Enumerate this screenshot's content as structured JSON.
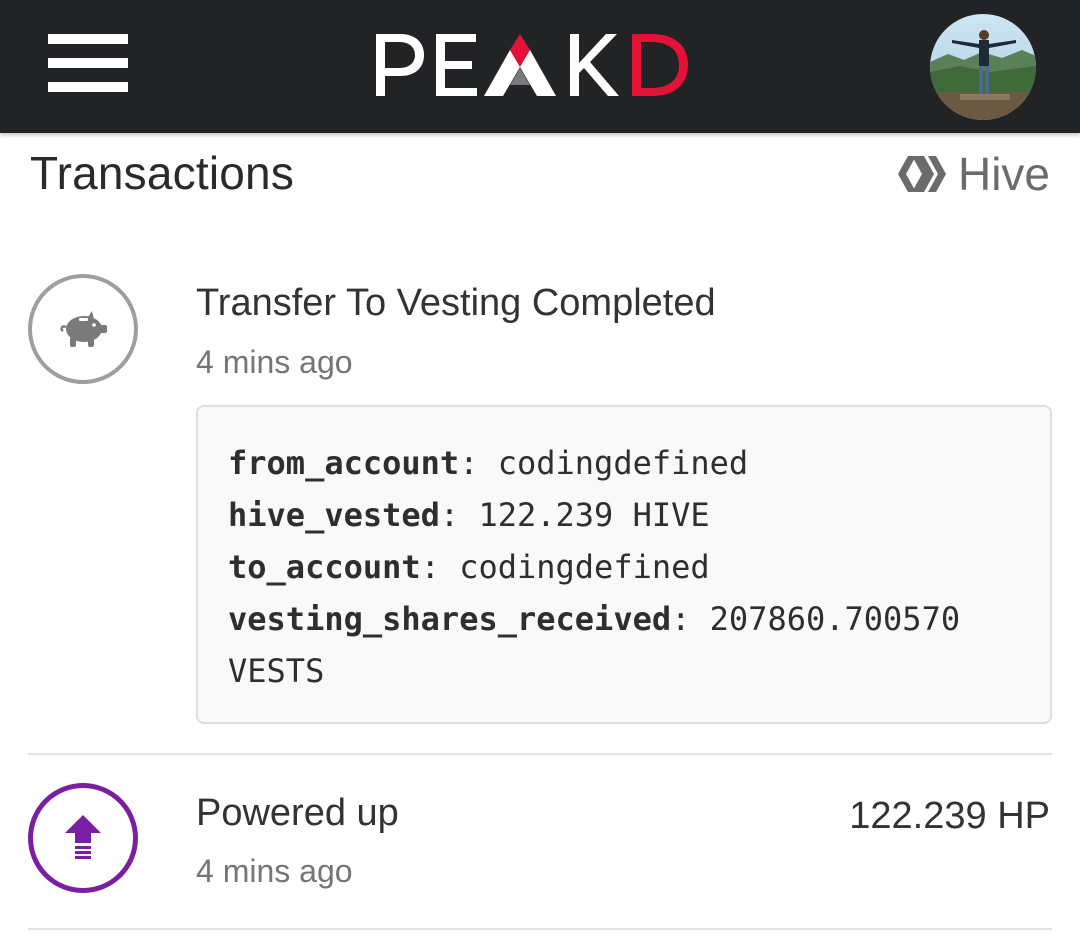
{
  "header": {
    "logo_text": "PEAKD",
    "menu_icon": "hamburger-menu-icon",
    "avatar_icon": "user-avatar"
  },
  "page": {
    "title": "Transactions",
    "network_label": "Hive",
    "network_icon": "hive-logo-icon"
  },
  "transactions": [
    {
      "title": "Transfer To Vesting Completed",
      "time": "4 mins ago",
      "icon": "piggy-bank-icon",
      "details": [
        {
          "key": "from_account",
          "value": "codingdefined"
        },
        {
          "key": "hive_vested",
          "value": "122.239 HIVE"
        },
        {
          "key": "to_account",
          "value": "codingdefined"
        },
        {
          "key": "vesting_shares_received",
          "value": "207860.700570 VESTS"
        }
      ]
    },
    {
      "title": "Powered up",
      "time": "4 mins ago",
      "amount": "122.239 HP",
      "icon": "power-up-arrow-icon"
    }
  ],
  "colors": {
    "topbar": "#222324",
    "logo_accent": "#e31337",
    "power_up": "#7b1fa2",
    "muted_icon": "#9e9e9e"
  }
}
